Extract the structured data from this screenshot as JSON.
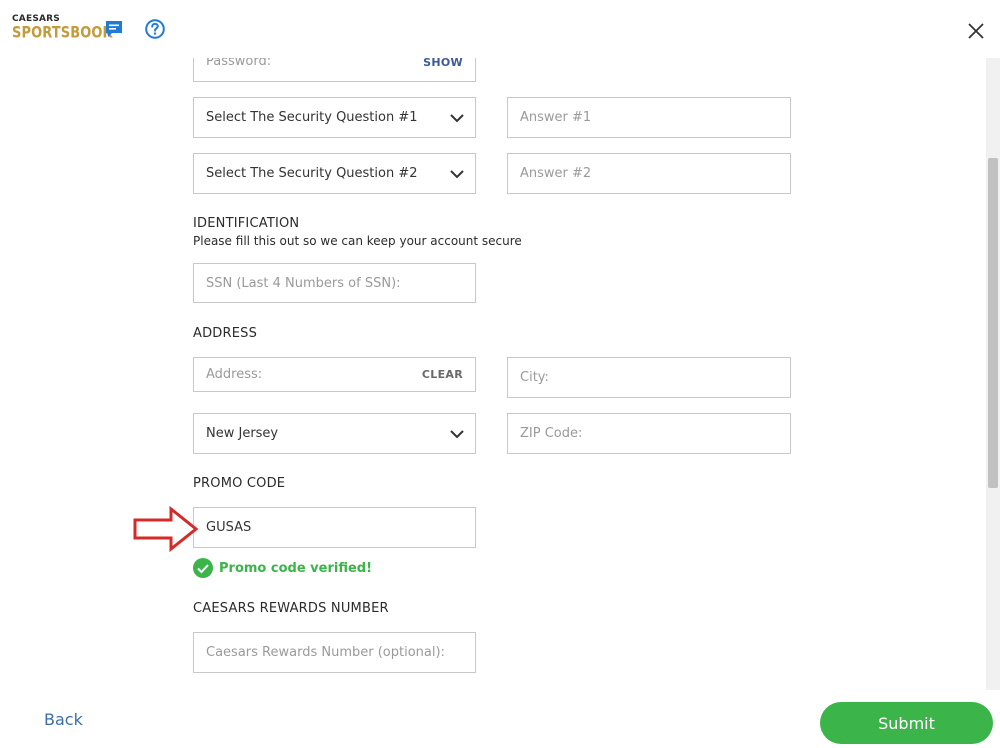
{
  "header": {
    "logo_line1": "CAESARS",
    "logo_line2": "SPORTSBOOK",
    "chat_icon": "chat-icon",
    "help_icon": "help-icon",
    "close_icon": "close-icon"
  },
  "account": {
    "password_placeholder": "Password:",
    "password_toggle": "SHOW",
    "question1_label": "Select The Security Question #1",
    "answer1_placeholder": "Answer #1",
    "question2_label": "Select The Security Question #2",
    "answer2_placeholder": "Answer #2"
  },
  "identification": {
    "title": "IDENTIFICATION",
    "subtitle": "Please fill this out so we can keep your account secure",
    "ssn_placeholder": "SSN (Last 4 Numbers of SSN):"
  },
  "address": {
    "title": "ADDRESS",
    "address_placeholder": "Address:",
    "clear_label": "CLEAR",
    "city_placeholder": "City:",
    "state_value": "New Jersey",
    "zip_placeholder": "ZIP Code:"
  },
  "promo": {
    "title": "PROMO CODE",
    "code_value": "GUSAS",
    "verified_text": "Promo code verified!"
  },
  "rewards": {
    "title": "CAESARS REWARDS NUMBER",
    "number_placeholder": "Caesars Rewards Number (optional):"
  },
  "footer": {
    "back_label": "Back",
    "submit_label": "Submit"
  },
  "colors": {
    "accent_green": "#3bb54a",
    "link_blue": "#3c6ea8",
    "brand_gold": "#c49a3b",
    "arrow_red": "#d42a2a"
  }
}
